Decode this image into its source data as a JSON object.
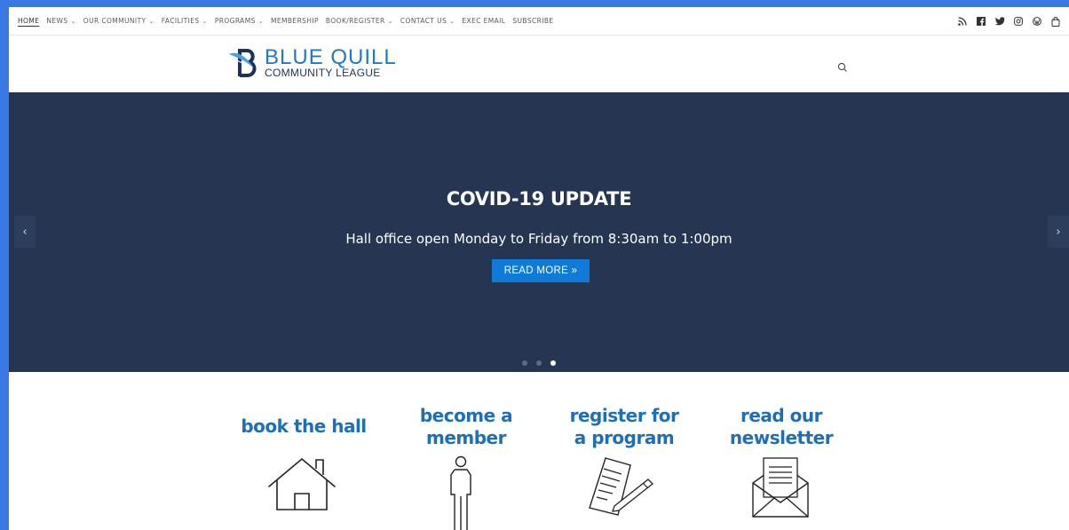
{
  "nav": {
    "items": [
      {
        "label": "HOME",
        "dropdown": false,
        "active": true
      },
      {
        "label": "NEWS",
        "dropdown": true
      },
      {
        "label": "OUR COMMUNITY",
        "dropdown": true
      },
      {
        "label": "FACILITIES",
        "dropdown": true
      },
      {
        "label": "PROGRAMS",
        "dropdown": true
      },
      {
        "label": "MEMBERSHIP",
        "dropdown": false
      },
      {
        "label": "BOOK/REGISTER",
        "dropdown": true
      },
      {
        "label": "CONTACT US",
        "dropdown": true
      },
      {
        "label": "EXEC EMAIL",
        "dropdown": false
      },
      {
        "label": "SUBSCRIBE",
        "dropdown": false
      }
    ],
    "chevron": "⌄",
    "social_icons": [
      "rss-icon",
      "facebook-icon",
      "twitter-icon",
      "instagram-icon",
      "wordpress-icon",
      "shopping-bag-icon"
    ]
  },
  "logo": {
    "line1": "BLUE QUILL",
    "line2": "COMMUNITY LEAGUE"
  },
  "slider": {
    "title": "COVID-19 UPDATE",
    "subtitle": "Hall office open Monday to Friday from 8:30am to 1:00pm",
    "button": "READ MORE »",
    "prev": "‹",
    "next": "›",
    "slide_count": 3,
    "active_slide": 3
  },
  "features": {
    "book": "book the hall",
    "member_l1": "become a",
    "member_l2": "member",
    "program_l1": "register for",
    "program_l2": "a program",
    "newsletter_l1": "read our",
    "newsletter_l2": "newsletter"
  },
  "colors": {
    "page_bg": "#3a78e6",
    "hero_bg": "#263652",
    "accent_blue": "#1f6fb8",
    "button_blue": "#0f7ad8"
  }
}
